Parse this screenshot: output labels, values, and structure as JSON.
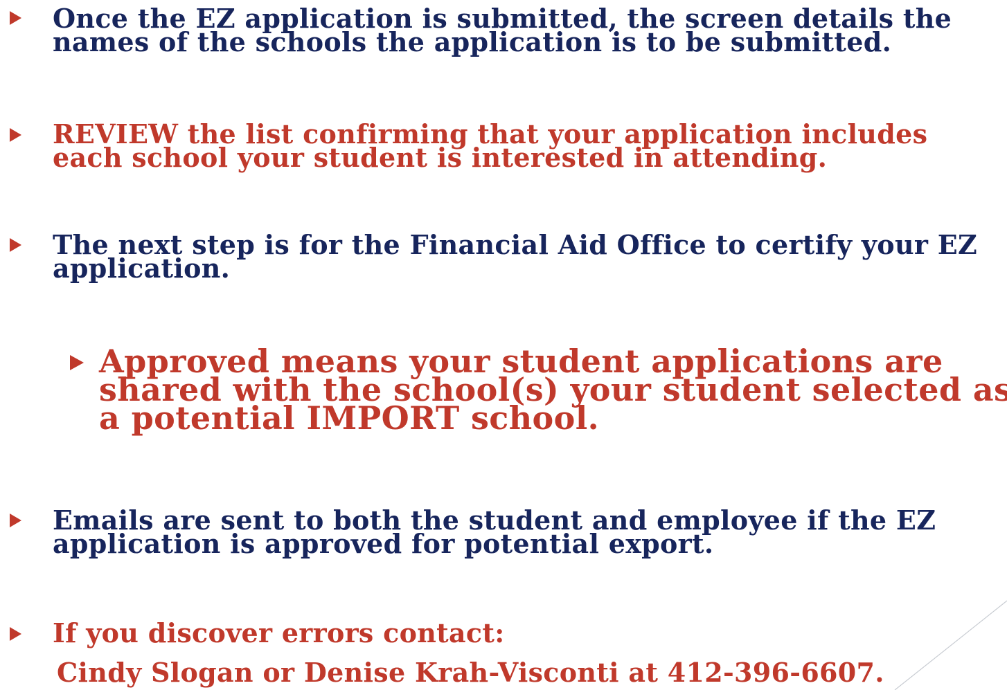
{
  "bullets": [
    {
      "level": 1,
      "color": "#17255c",
      "lines": [
        "Once the EZ application is submitted, the screen details the",
        "names of the schools the application is to be submitted."
      ]
    },
    {
      "level": 1,
      "color": "#c0392b",
      "lines": [
        "REVIEW the list confirming that your application includes",
        "each school your student is interested in attending."
      ]
    },
    {
      "level": 1,
      "color": "#17255c",
      "lines": [
        "The next step is for the Financial Aid Office to certify your EZ",
        "application."
      ]
    },
    {
      "level": 2,
      "color": "#c0392b",
      "lines": [
        "Approved means your student applications are",
        "shared with the school(s) your student selected as",
        "a potential IMPORT school."
      ]
    },
    {
      "level": 1,
      "color": "#17255c",
      "lines": [
        "Emails are sent to both the student and employee if the EZ",
        "application is approved for potential export."
      ]
    },
    {
      "level": 1,
      "color": "#c0392b",
      "lines": [
        "If you discover errors contact:"
      ]
    }
  ],
  "contact_line": "Cindy Slogan or Denise Krah-Visconti at 412-396-6607.",
  "colors": {
    "navy": "#17255c",
    "red": "#c0392b",
    "arrow": "#c0392b"
  }
}
